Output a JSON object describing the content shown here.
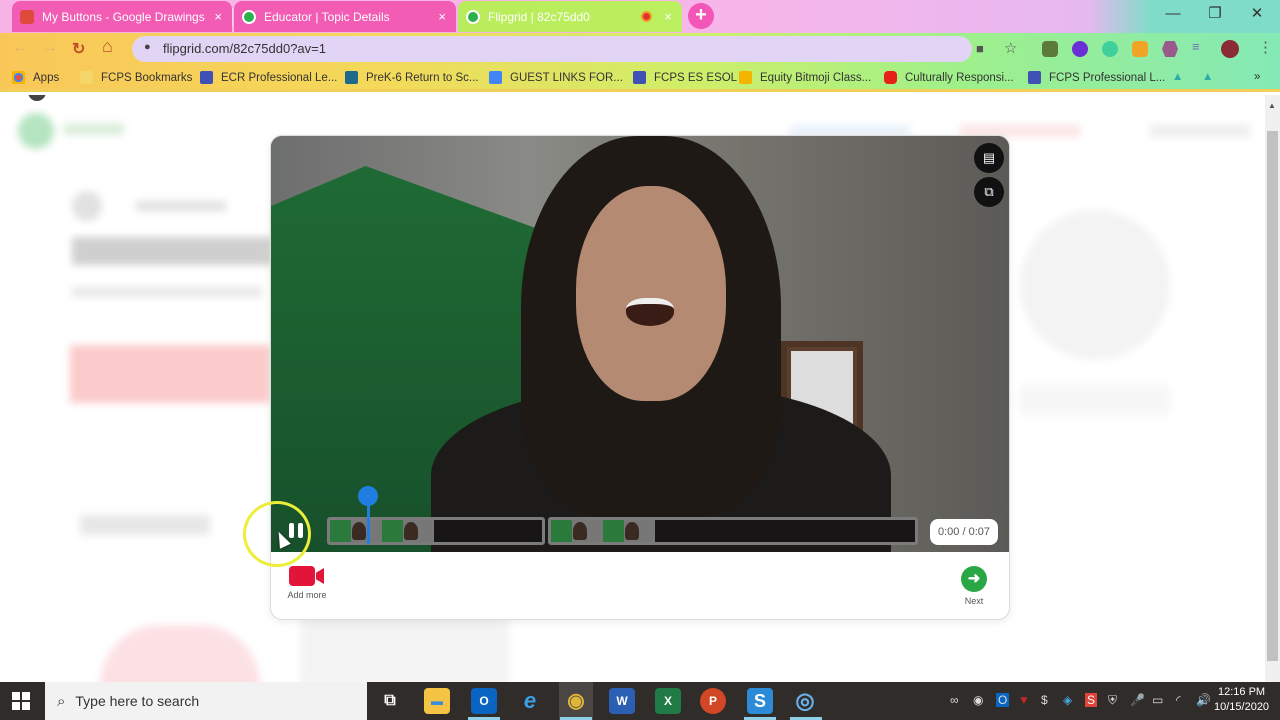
{
  "browser": {
    "tabs": [
      {
        "title": "My Buttons - Google Drawings",
        "active": false,
        "icon": "google-drawings-icon",
        "icon_color": "#e04a3c"
      },
      {
        "title": "Educator | Topic Details",
        "active": false,
        "icon": "flipgrid-icon",
        "icon_color": "#2bb24c"
      },
      {
        "title": "Flipgrid | 82c75dd0",
        "active": true,
        "icon": "flipgrid-icon",
        "icon_color": "#2bb24c",
        "recording": true
      }
    ],
    "tab_close_glyph": "×",
    "new_tab_glyph": "+",
    "window_controls": {
      "minimize": "—",
      "restore": "❐",
      "close": "✕"
    },
    "nav": {
      "back": "←",
      "forward": "→",
      "reload": "↻",
      "home": "⌂"
    },
    "address": {
      "lock": "🔒",
      "url": "flipgrid.com/82c75dd0?av=1"
    },
    "omnibox_icons": {
      "camera": "■",
      "star": "☆"
    },
    "menu_glyph": "⋮",
    "bookmarks": [
      {
        "label": "Apps",
        "icon": "apps-grid-icon",
        "color": "#e84d3d"
      },
      {
        "label": "FCPS Bookmarks",
        "icon": "folder-icon",
        "color": "#f6d66a"
      },
      {
        "label": "ECR Professional Le...",
        "icon": "forms-icon",
        "color": "#3f51b5"
      },
      {
        "label": "PreK-6 Return to Sc...",
        "icon": "site-icon",
        "color": "#1f6a8a"
      },
      {
        "label": "GUEST LINKS FOR...",
        "icon": "docs-icon",
        "color": "#4285f4"
      },
      {
        "label": "FCPS ES ESOL",
        "icon": "forms-icon",
        "color": "#3f51b5"
      },
      {
        "label": "Equity Bitmoji Class...",
        "icon": "slides-icon",
        "color": "#f4b400"
      },
      {
        "label": "Culturally Responsi...",
        "icon": "youtube-icon",
        "color": "#e62117"
      },
      {
        "label": "FCPS Professional L...",
        "icon": "forms-icon",
        "color": "#3f51b5"
      }
    ],
    "bookmarks_overflow": "»"
  },
  "recorder": {
    "side_buttons": [
      {
        "name": "notes",
        "glyph": "▤"
      },
      {
        "name": "mirror",
        "glyph": "⧉"
      }
    ],
    "playback": {
      "state": "playing",
      "pause_glyph": "❚❚",
      "current": "0:00",
      "total": "0:07",
      "time_display": "0:00 / 0:07",
      "progress": 0.0
    },
    "clips": [
      {
        "index": 1,
        "thumbnails": 2
      },
      {
        "index": 2,
        "thumbnails": 2
      }
    ],
    "add_more_label": "Add more",
    "next_label": "Next",
    "next_glyph": "➜",
    "accent_red": "#e2143a",
    "accent_green": "#2aa745",
    "playhead_color": "#1f7ee0"
  },
  "taskbar": {
    "search_placeholder": "Type here to search",
    "search_glyph": "⌕",
    "apps": [
      {
        "name": "task-view",
        "glyph": "⧉",
        "color": "transparent"
      },
      {
        "name": "file-explorer",
        "glyph": "▬",
        "color": "#f6c445"
      },
      {
        "name": "outlook",
        "glyph": "O",
        "color": "#0a64c2"
      },
      {
        "name": "internet-explorer",
        "glyph": "e",
        "color": "transparent"
      },
      {
        "name": "chrome",
        "glyph": "◉",
        "color": "transparent"
      },
      {
        "name": "word",
        "glyph": "W",
        "color": "#2b5fb4"
      },
      {
        "name": "excel",
        "glyph": "X",
        "color": "#1f7a45"
      },
      {
        "name": "powerpoint",
        "glyph": "P",
        "color": "#d24726"
      },
      {
        "name": "snagit",
        "glyph": "S",
        "color": "#2d8ad6"
      },
      {
        "name": "screen-recorder",
        "glyph": "◎",
        "color": "transparent"
      }
    ],
    "tray_icons": [
      "∞",
      "◉",
      "O",
      "▼",
      "$",
      "◈",
      "S",
      "⛨",
      "🎤",
      "▭",
      "◜",
      "🔊"
    ],
    "time": "12:16 PM",
    "date": "10/15/2020"
  }
}
